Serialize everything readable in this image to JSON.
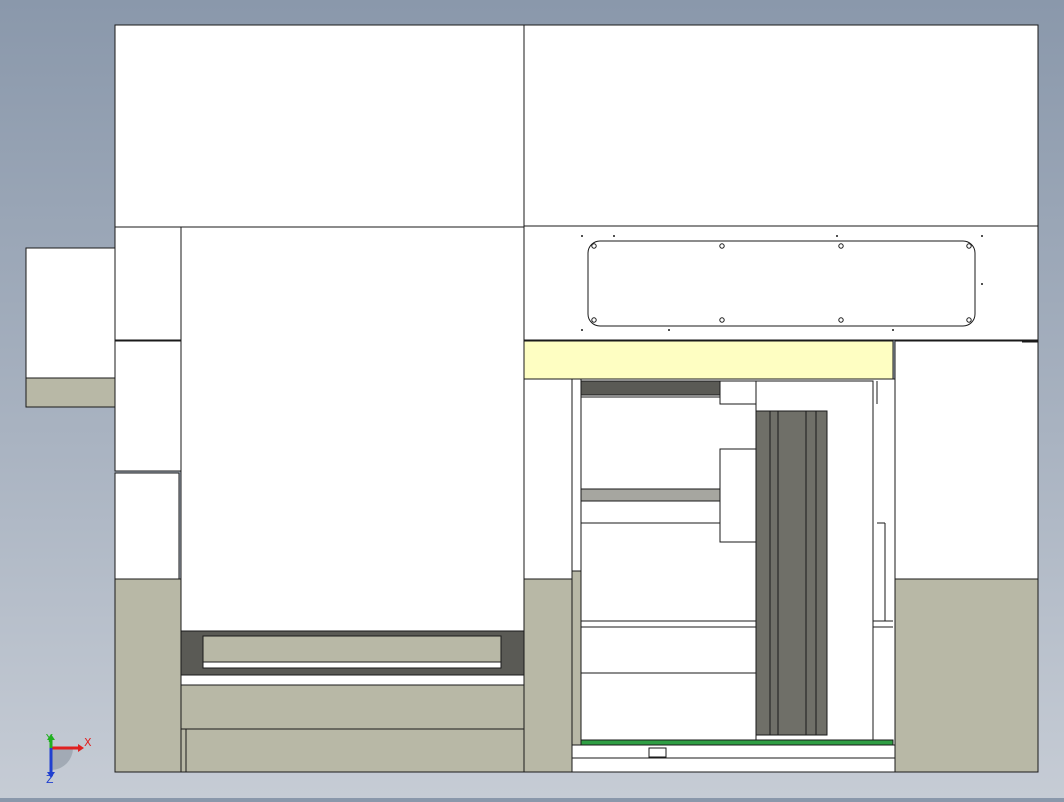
{
  "viewport": {
    "background_top": "#8a98ab",
    "background_bottom": "#c6ccd5"
  },
  "model": {
    "colors": {
      "face": "#ffffff",
      "edge": "#1a1a1a",
      "khaki": "#b8b8a6",
      "dark_gray": "#5a5a55",
      "panel_gray": "#6f6f68",
      "rail_gray": "#a6a6a0",
      "light_yellow": "#fefec2",
      "green_strip": "#2f9e44"
    }
  },
  "triad": {
    "x_label": "X",
    "y_label": "Y",
    "z_label": "Z",
    "x_color": "#e02020",
    "y_color": "#20b020",
    "z_color": "#2040d0",
    "icon": "coordinate-triad-icon"
  }
}
